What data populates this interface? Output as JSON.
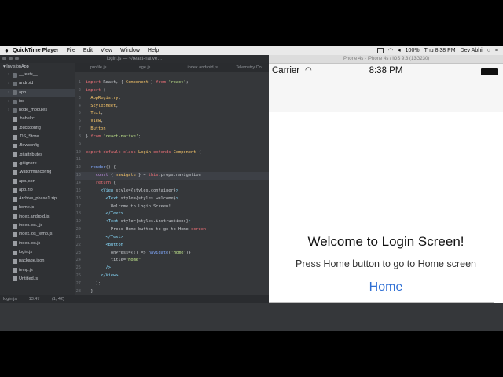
{
  "menubar": {
    "app": "QuickTime Player",
    "items": [
      "File",
      "Edit",
      "View",
      "Window",
      "Help"
    ],
    "battery": "100%",
    "clock": "Thu 8:38 PM",
    "user": "Dev Abhi"
  },
  "editor": {
    "title": "login.js — ~/react-native…",
    "project": "InvisionApp",
    "tabs": [
      "profile.js",
      "age.js",
      "index.android.js",
      "Telemetry Co…"
    ],
    "tree": [
      {
        "name": "__tests__",
        "kind": "folder"
      },
      {
        "name": "android",
        "kind": "folder"
      },
      {
        "name": "app",
        "kind": "folder",
        "selected": true
      },
      {
        "name": "ios",
        "kind": "folder"
      },
      {
        "name": "node_modules",
        "kind": "folder"
      },
      {
        "name": ".babelrc",
        "kind": "file"
      },
      {
        "name": ".buckconfig",
        "kind": "file"
      },
      {
        "name": ".DS_Store",
        "kind": "file"
      },
      {
        "name": ".flowconfig",
        "kind": "file"
      },
      {
        "name": ".gitattributes",
        "kind": "file"
      },
      {
        "name": ".gitignore",
        "kind": "file"
      },
      {
        "name": ".watchmanconfig",
        "kind": "file"
      },
      {
        "name": "app.json",
        "kind": "file"
      },
      {
        "name": "app.zip",
        "kind": "file"
      },
      {
        "name": "Archive_phase1.zip",
        "kind": "file"
      },
      {
        "name": "home.js",
        "kind": "file"
      },
      {
        "name": "index.android.js",
        "kind": "file"
      },
      {
        "name": "index.ios._js",
        "kind": "file"
      },
      {
        "name": "index.ios_temp.js",
        "kind": "file"
      },
      {
        "name": "index.ios.js",
        "kind": "file"
      },
      {
        "name": "login.js",
        "kind": "file"
      },
      {
        "name": "package.json",
        "kind": "file"
      },
      {
        "name": "temp.js",
        "kind": "file"
      },
      {
        "name": "Untitled.js",
        "kind": "file"
      }
    ],
    "status_file": "login.js",
    "status_pos": "13:47",
    "status_sel": "(1, 42)"
  },
  "simulator": {
    "title": "iPhone 4s - iPhone 4s / iOS 9.3 (13G230)",
    "carrier": "Carrier",
    "time": "8:38 PM",
    "welcome": "Welcome to Login Screen!",
    "instructions": "Press Home button to go to Home screen",
    "home_button": "Home"
  },
  "icons": {
    "apple": "apple-icon",
    "wifi": "wifi-icon",
    "battery": "battery-icon"
  }
}
